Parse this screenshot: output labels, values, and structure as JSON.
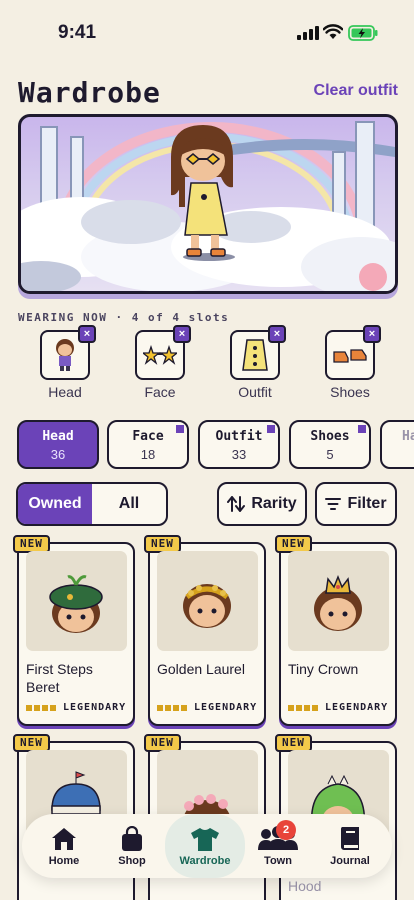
{
  "status_bar": {
    "time": "9:41"
  },
  "header": {
    "title": "Wardrobe",
    "clear_label": "Clear outfit"
  },
  "wearing": {
    "label": "WEARING NOW · 4 of 4 slots",
    "slots": [
      {
        "label": "Head"
      },
      {
        "label": "Face"
      },
      {
        "label": "Outfit"
      },
      {
        "label": "Shoes"
      }
    ],
    "remove_symbol": "×"
  },
  "categories": [
    {
      "name": "Head",
      "count": "36"
    },
    {
      "name": "Face",
      "count": "18"
    },
    {
      "name": "Outfit",
      "count": "33"
    },
    {
      "name": "Shoes",
      "count": "5"
    },
    {
      "name": "Ha",
      "count": ""
    }
  ],
  "filters": {
    "owned_label": "Owned",
    "all_label": "All",
    "rarity_label": "Rarity",
    "filter_label": "Filter"
  },
  "items": [
    {
      "badge": "NEW",
      "name": "First Steps Beret",
      "rarity": "LEGENDARY"
    },
    {
      "badge": "NEW",
      "name": "Golden Laurel",
      "rarity": "LEGENDARY"
    },
    {
      "badge": "NEW",
      "name": "Tiny Crown",
      "rarity": "LEGENDARY"
    },
    {
      "badge": "NEW",
      "name": "",
      "rarity": ""
    },
    {
      "badge": "NEW",
      "name": "",
      "rarity": ""
    },
    {
      "badge": "NEW",
      "name": "Hood",
      "rarity": ""
    }
  ],
  "tabbar": {
    "tabs": [
      {
        "label": "Home",
        "icon": "home-icon"
      },
      {
        "label": "Shop",
        "icon": "shopping-bag-icon"
      },
      {
        "label": "Wardrobe",
        "icon": "shirt-icon"
      },
      {
        "label": "Town",
        "icon": "people-icon"
      },
      {
        "label": "Journal",
        "icon": "book-icon"
      }
    ],
    "town_badge": "2"
  },
  "colors": {
    "accent": "#6b43b8",
    "background": "#f4efe3",
    "gold": "#d6a21c",
    "active_tab": "#176656"
  }
}
